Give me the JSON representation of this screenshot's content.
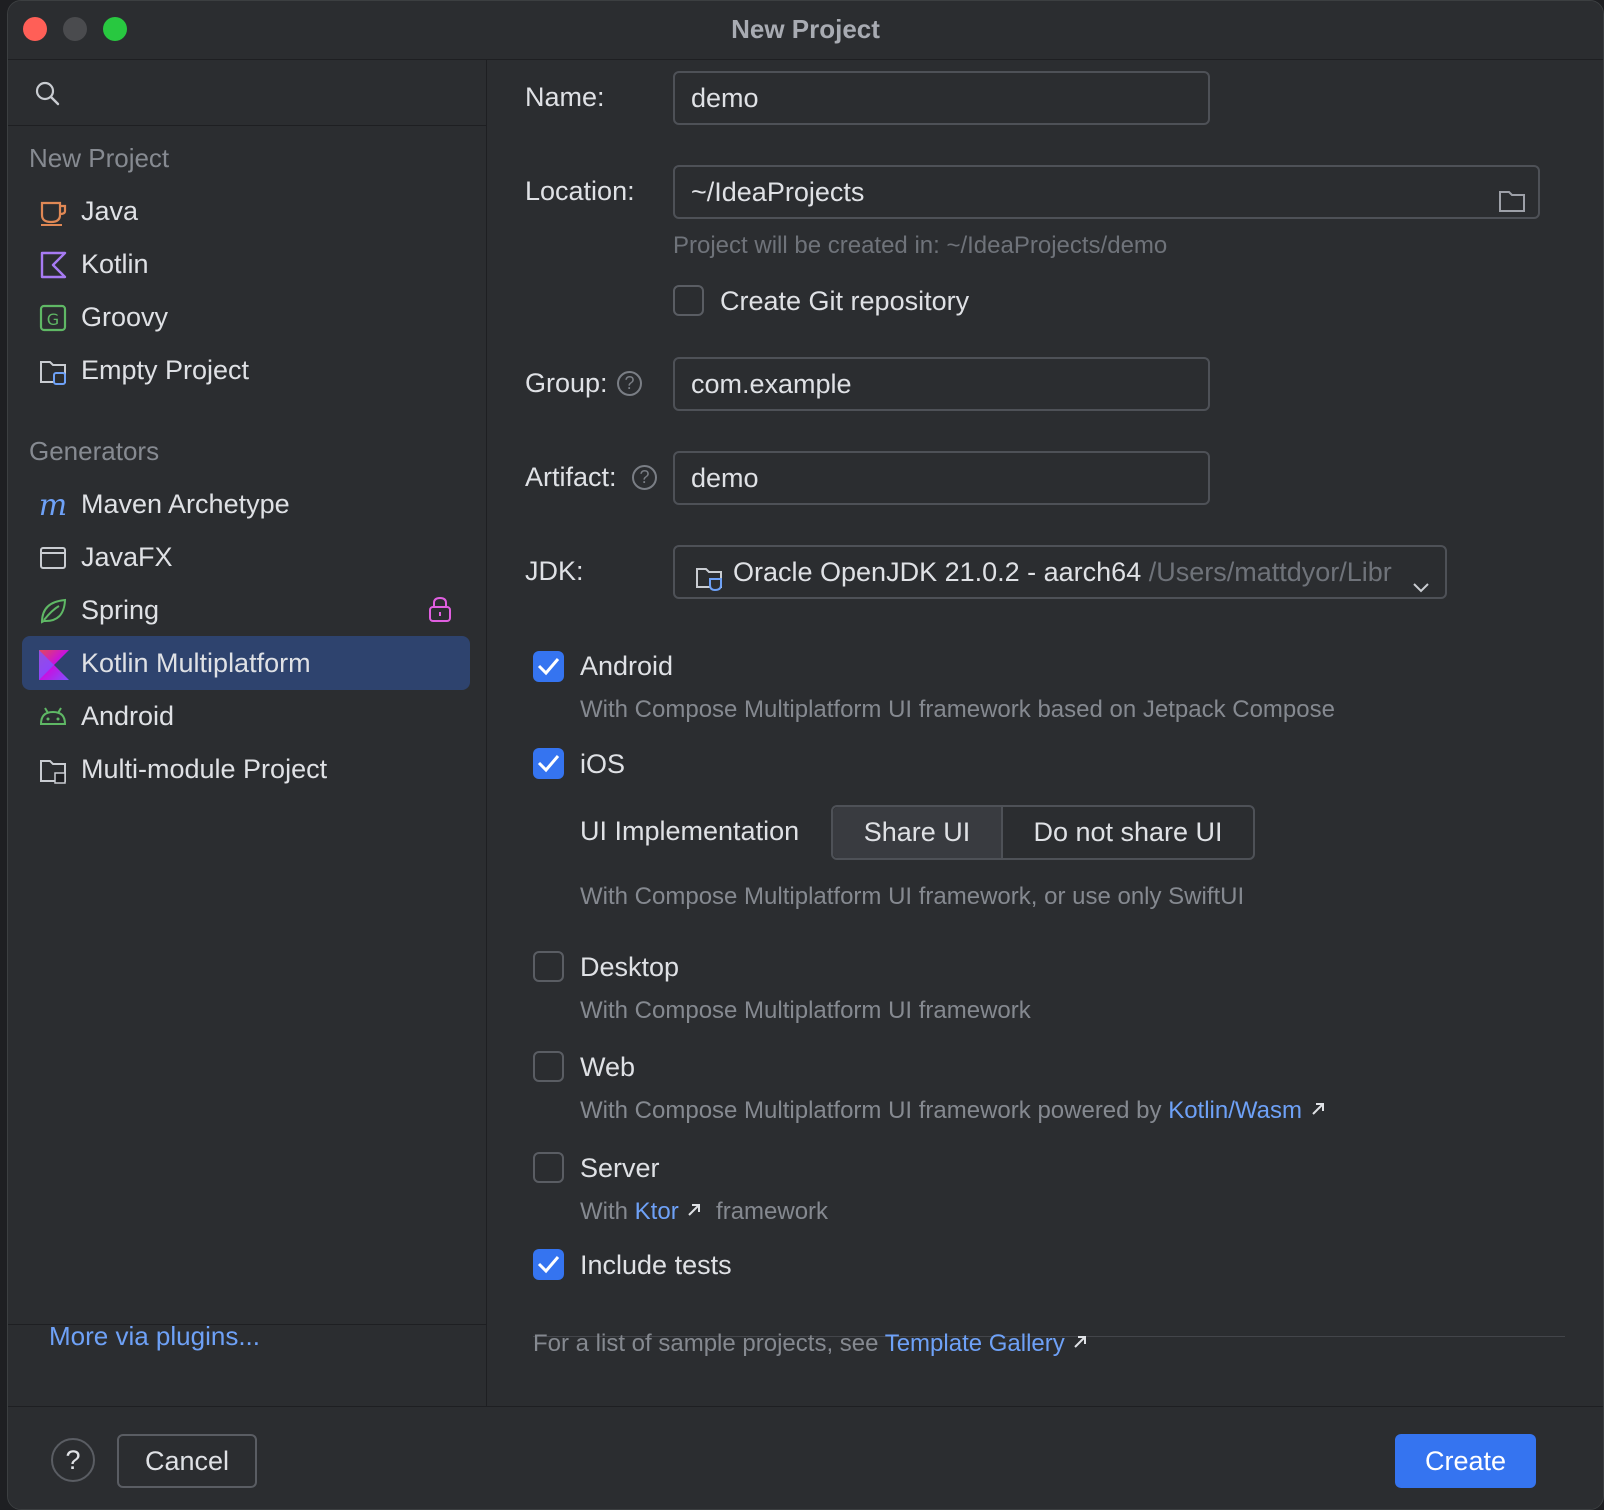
{
  "window": {
    "title": "New Project"
  },
  "sidebar": {
    "search_placeholder": "",
    "section_new": "New Project",
    "new_items": [
      {
        "label": "Java",
        "icon": "java-cup-icon"
      },
      {
        "label": "Kotlin",
        "icon": "kotlin-icon"
      },
      {
        "label": "Groovy",
        "icon": "groovy-icon"
      },
      {
        "label": "Empty Project",
        "icon": "empty-project-icon"
      }
    ],
    "section_generators": "Generators",
    "generator_items": [
      {
        "label": "Maven Archetype",
        "icon": "maven-icon"
      },
      {
        "label": "JavaFX",
        "icon": "javafx-icon"
      },
      {
        "label": "Spring",
        "icon": "spring-leaf-icon",
        "locked": true
      },
      {
        "label": "Kotlin Multiplatform",
        "icon": "kotlin-multiplatform-icon",
        "selected": true
      },
      {
        "label": "Android",
        "icon": "android-icon"
      },
      {
        "label": "Multi-module Project",
        "icon": "multi-module-icon"
      }
    ],
    "plugins_link": "More via plugins..."
  },
  "form": {
    "name_label": "Name:",
    "name_value": "demo",
    "location_label": "Location:",
    "location_value": "~/IdeaProjects",
    "location_hint": "Project will be created in: ~/IdeaProjects/demo",
    "git_label": "Create Git repository",
    "git_checked": false,
    "group_label": "Group:",
    "group_value": "com.example",
    "artifact_label": "Artifact:",
    "artifact_value": "demo",
    "jdk_label": "JDK:",
    "jdk_value": "Oracle OpenJDK 21.0.2 - aarch64",
    "jdk_path": "/Users/mattdyor/Libr",
    "help_glyph": "?"
  },
  "targets": {
    "android": {
      "label": "Android",
      "checked": true,
      "desc": "With Compose Multiplatform UI framework based on Jetpack Compose"
    },
    "ios": {
      "label": "iOS",
      "checked": true
    },
    "ui_impl_label": "UI Implementation",
    "ui_impl_options": [
      "Share UI",
      "Do not share UI"
    ],
    "ui_impl_selected": "Share UI",
    "ios_desc": "With Compose Multiplatform UI framework, or use only SwiftUI",
    "desktop": {
      "label": "Desktop",
      "checked": false,
      "desc": "With Compose Multiplatform UI framework"
    },
    "web": {
      "label": "Web",
      "checked": false,
      "desc_prefix": "With Compose Multiplatform UI framework powered by",
      "desc_link": "Kotlin/Wasm"
    },
    "server": {
      "label": "Server",
      "checked": false,
      "desc_prefix": "With",
      "desc_link": "Ktor",
      "desc_suffix": "framework"
    },
    "tests": {
      "label": "Include tests",
      "checked": true
    }
  },
  "gallery": {
    "prefix": "For a list of sample projects, see",
    "link": "Template Gallery"
  },
  "footer": {
    "help_glyph": "?",
    "cancel_label": "Cancel",
    "create_label": "Create"
  },
  "colors": {
    "accent": "#3574f0",
    "link": "#6ea1f7",
    "selected_row": "#2e436e"
  }
}
